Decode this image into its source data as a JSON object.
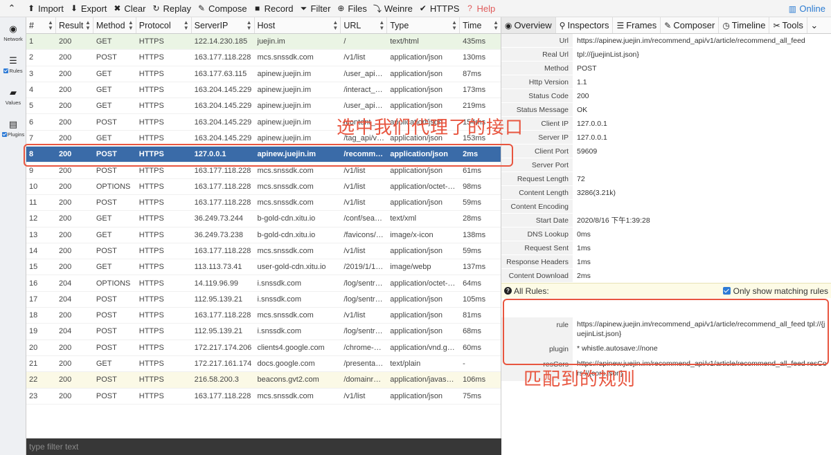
{
  "toolbar": {
    "items": [
      {
        "icon": "upload-icon",
        "label": "Import",
        "glyph": "⬆"
      },
      {
        "icon": "download-icon",
        "label": "Export",
        "glyph": "⬇"
      },
      {
        "icon": "close-icon",
        "label": "Clear",
        "glyph": "✖"
      },
      {
        "icon": "replay-icon",
        "label": "Replay",
        "glyph": "↻"
      },
      {
        "icon": "compose-icon",
        "label": "Compose",
        "glyph": "✎"
      },
      {
        "icon": "record-icon",
        "label": "Record",
        "glyph": "■"
      },
      {
        "icon": "filter-icon",
        "label": "Filter",
        "glyph": "⏷"
      },
      {
        "icon": "files-icon",
        "label": "Files",
        "glyph": "⊕"
      },
      {
        "icon": "weinre-icon",
        "label": "Weinre",
        "glyph": "⤵"
      },
      {
        "icon": "https-icon",
        "label": "HTTPS",
        "glyph": "✔"
      },
      {
        "icon": "help-icon",
        "label": "Help",
        "glyph": "?"
      }
    ],
    "online_label": "Online",
    "help_color": "#e05a5a",
    "online_color": "#2b7bd1"
  },
  "sidebar": {
    "items": [
      {
        "icon": "globe-icon",
        "glyph": "◉",
        "label": "Network",
        "checkbox": false
      },
      {
        "icon": "list-icon",
        "glyph": "☰",
        "label": "Rules",
        "checkbox": true
      },
      {
        "icon": "folder-icon",
        "glyph": "▰",
        "label": "Values",
        "checkbox": false
      },
      {
        "icon": "plugins-icon",
        "glyph": "▤",
        "label": "Plugins",
        "checkbox": true
      }
    ]
  },
  "network": {
    "columns": [
      "#",
      "Result",
      "Method",
      "Protocol",
      "ServerIP",
      "Host",
      "URL",
      "Type",
      "Time"
    ],
    "selected_color": "#3a6ba8",
    "rows": [
      {
        "num": "1",
        "result": "200",
        "method": "GET",
        "protocol": "HTTPS",
        "ip": "122.14.230.185",
        "host": "juejin.im",
        "url": "/",
        "type": "text/html",
        "time": "435ms",
        "style": "green"
      },
      {
        "num": "2",
        "result": "200",
        "method": "POST",
        "protocol": "HTTPS",
        "ip": "163.177.118.228",
        "host": "mcs.snssdk.com",
        "url": "/v1/list",
        "type": "application/json",
        "time": "130ms",
        "style": ""
      },
      {
        "num": "3",
        "result": "200",
        "method": "GET",
        "protocol": "HTTPS",
        "ip": "163.177.63.115",
        "host": "apinew.juejin.im",
        "url": "/user_api/v...",
        "type": "application/json",
        "time": "87ms",
        "style": ""
      },
      {
        "num": "4",
        "result": "200",
        "method": "GET",
        "protocol": "HTTPS",
        "ip": "163.204.145.229",
        "host": "apinew.juejin.im",
        "url": "/interact_a...",
        "type": "application/json",
        "time": "173ms",
        "style": ""
      },
      {
        "num": "5",
        "result": "200",
        "method": "GET",
        "protocol": "HTTPS",
        "ip": "163.204.145.229",
        "host": "apinew.juejin.im",
        "url": "/user_api/v...",
        "type": "application/json",
        "time": "219ms",
        "style": ""
      },
      {
        "num": "6",
        "result": "200",
        "method": "POST",
        "protocol": "HTTPS",
        "ip": "163.204.145.229",
        "host": "apinew.juejin.im",
        "url": "/content_a...",
        "type": "application/json",
        "time": "154ms",
        "style": ""
      },
      {
        "num": "7",
        "result": "200",
        "method": "GET",
        "protocol": "HTTPS",
        "ip": "163.204.145.229",
        "host": "apinew.juejin.im",
        "url": "/tag_api/v1...",
        "type": "application/json",
        "time": "153ms",
        "style": ""
      },
      {
        "num": "8",
        "result": "200",
        "method": "POST",
        "protocol": "HTTPS",
        "ip": "127.0.0.1",
        "host": "apinew.juejin.im",
        "url": "/recomme...",
        "type": "application/json",
        "time": "2ms",
        "style": "selected"
      },
      {
        "num": "9",
        "result": "200",
        "method": "POST",
        "protocol": "HTTPS",
        "ip": "163.177.118.228",
        "host": "mcs.snssdk.com",
        "url": "/v1/list",
        "type": "application/json",
        "time": "61ms",
        "style": ""
      },
      {
        "num": "10",
        "result": "200",
        "method": "OPTIONS",
        "protocol": "HTTPS",
        "ip": "163.177.118.228",
        "host": "mcs.snssdk.com",
        "url": "/v1/list",
        "type": "application/octet-st...",
        "time": "98ms",
        "style": ""
      },
      {
        "num": "11",
        "result": "200",
        "method": "POST",
        "protocol": "HTTPS",
        "ip": "163.177.118.228",
        "host": "mcs.snssdk.com",
        "url": "/v1/list",
        "type": "application/json",
        "time": "59ms",
        "style": ""
      },
      {
        "num": "12",
        "result": "200",
        "method": "GET",
        "protocol": "HTTPS",
        "ip": "36.249.73.244",
        "host": "b-gold-cdn.xitu.io",
        "url": "/conf/searc...",
        "type": "text/xml",
        "time": "28ms",
        "style": ""
      },
      {
        "num": "13",
        "result": "200",
        "method": "GET",
        "protocol": "HTTPS",
        "ip": "36.249.73.238",
        "host": "b-gold-cdn.xitu.io",
        "url": "/favicons/v...",
        "type": "image/x-icon",
        "time": "138ms",
        "style": ""
      },
      {
        "num": "14",
        "result": "200",
        "method": "POST",
        "protocol": "HTTPS",
        "ip": "163.177.118.228",
        "host": "mcs.snssdk.com",
        "url": "/v1/list",
        "type": "application/json",
        "time": "59ms",
        "style": ""
      },
      {
        "num": "15",
        "result": "200",
        "method": "GET",
        "protocol": "HTTPS",
        "ip": "113.113.73.41",
        "host": "user-gold-cdn.xitu.io",
        "url": "/2019/1/14/...",
        "type": "image/webp",
        "time": "137ms",
        "style": ""
      },
      {
        "num": "16",
        "result": "204",
        "method": "OPTIONS",
        "protocol": "HTTPS",
        "ip": "14.119.96.99",
        "host": "i.snssdk.com",
        "url": "/log/sentry/...",
        "type": "application/octet-st...",
        "time": "64ms",
        "style": ""
      },
      {
        "num": "17",
        "result": "204",
        "method": "POST",
        "protocol": "HTTPS",
        "ip": "112.95.139.21",
        "host": "i.snssdk.com",
        "url": "/log/sentry/...",
        "type": "application/json",
        "time": "105ms",
        "style": ""
      },
      {
        "num": "18",
        "result": "200",
        "method": "POST",
        "protocol": "HTTPS",
        "ip": "163.177.118.228",
        "host": "mcs.snssdk.com",
        "url": "/v1/list",
        "type": "application/json",
        "time": "81ms",
        "style": ""
      },
      {
        "num": "19",
        "result": "204",
        "method": "POST",
        "protocol": "HTTPS",
        "ip": "112.95.139.21",
        "host": "i.snssdk.com",
        "url": "/log/sentry/...",
        "type": "application/json",
        "time": "68ms",
        "style": ""
      },
      {
        "num": "20",
        "result": "200",
        "method": "POST",
        "protocol": "HTTPS",
        "ip": "172.217.174.206",
        "host": "clients4.google.com",
        "url": "/chrome-sy...",
        "type": "application/vnd.goo...",
        "time": "60ms",
        "style": ""
      },
      {
        "num": "21",
        "result": "200",
        "method": "GET",
        "protocol": "HTTPS",
        "ip": "172.217.161.174",
        "host": "docs.google.com",
        "url": "/presentati...",
        "type": "text/plain",
        "time": "-",
        "style": ""
      },
      {
        "num": "22",
        "result": "200",
        "method": "POST",
        "protocol": "HTTPS",
        "ip": "216.58.200.3",
        "host": "beacons.gvt2.com",
        "url": "/domainreli...",
        "type": "application/javascript",
        "time": "106ms",
        "style": "yellow"
      },
      {
        "num": "23",
        "result": "200",
        "method": "POST",
        "protocol": "HTTPS",
        "ip": "163.177.118.228",
        "host": "mcs.snssdk.com",
        "url": "/v1/list",
        "type": "application/json",
        "time": "75ms",
        "style": ""
      }
    ],
    "filter_placeholder": "type filter text"
  },
  "detail": {
    "tabs": [
      {
        "icon": "eye-icon",
        "glyph": "◉",
        "label": "Overview",
        "active": true
      },
      {
        "icon": "search-icon",
        "glyph": "⚲",
        "label": "Inspectors",
        "active": false
      },
      {
        "icon": "frames-icon",
        "glyph": "☰",
        "label": "Frames",
        "active": false
      },
      {
        "icon": "compose-icon",
        "glyph": "✎",
        "label": "Composer",
        "active": false
      },
      {
        "icon": "timeline-icon",
        "glyph": "◷",
        "label": "Timeline",
        "active": false
      },
      {
        "icon": "wrench-icon",
        "glyph": "✂",
        "label": "Tools",
        "active": false
      }
    ],
    "overview": [
      {
        "key": "Url",
        "value": "https://apinew.juejin.im/recommend_api/v1/article/recommend_all_feed"
      },
      {
        "key": "Real Url",
        "value": "tpl://{juejinList.json}"
      },
      {
        "key": "Method",
        "value": "POST"
      },
      {
        "key": "Http Version",
        "value": "1.1"
      },
      {
        "key": "Status Code",
        "value": "200"
      },
      {
        "key": "Status Message",
        "value": "OK"
      },
      {
        "key": "Client IP",
        "value": "127.0.0.1"
      },
      {
        "key": "Server IP",
        "value": "127.0.0.1"
      },
      {
        "key": "Client Port",
        "value": "59609"
      },
      {
        "key": "Server Port",
        "value": ""
      },
      {
        "key": "Request Length",
        "value": "72"
      },
      {
        "key": "Content Length",
        "value": "3286(3.21k)"
      },
      {
        "key": "Content Encoding",
        "value": ""
      },
      {
        "key": "Start Date",
        "value": "2020/8/16 下午1:39:28"
      },
      {
        "key": "DNS Lookup",
        "value": "0ms"
      },
      {
        "key": "Request Sent",
        "value": "1ms"
      },
      {
        "key": "Response Headers",
        "value": "1ms"
      },
      {
        "key": "Content Download",
        "value": "2ms"
      }
    ],
    "rules_title": "All Rules:",
    "only_matching_label": "Only show matching rules",
    "rules": [
      {
        "key": "rule",
        "value": "https://apinew.juejin.im/recommend_api/v1/article/recommend_all_feed tpl://{juejinList.json}"
      },
      {
        "key": "plugin",
        "value": "* whistle.autosave://none"
      },
      {
        "key": "resCors",
        "value": "https://apinew.juejin.im/recommend_api/v1/article/recommend_all_feed resCors://{cors.json}"
      }
    ]
  },
  "annotations": {
    "selected_note": "选中我们代理了的接口",
    "rules_note": "匹配到的规则",
    "color": "#e8553f"
  }
}
